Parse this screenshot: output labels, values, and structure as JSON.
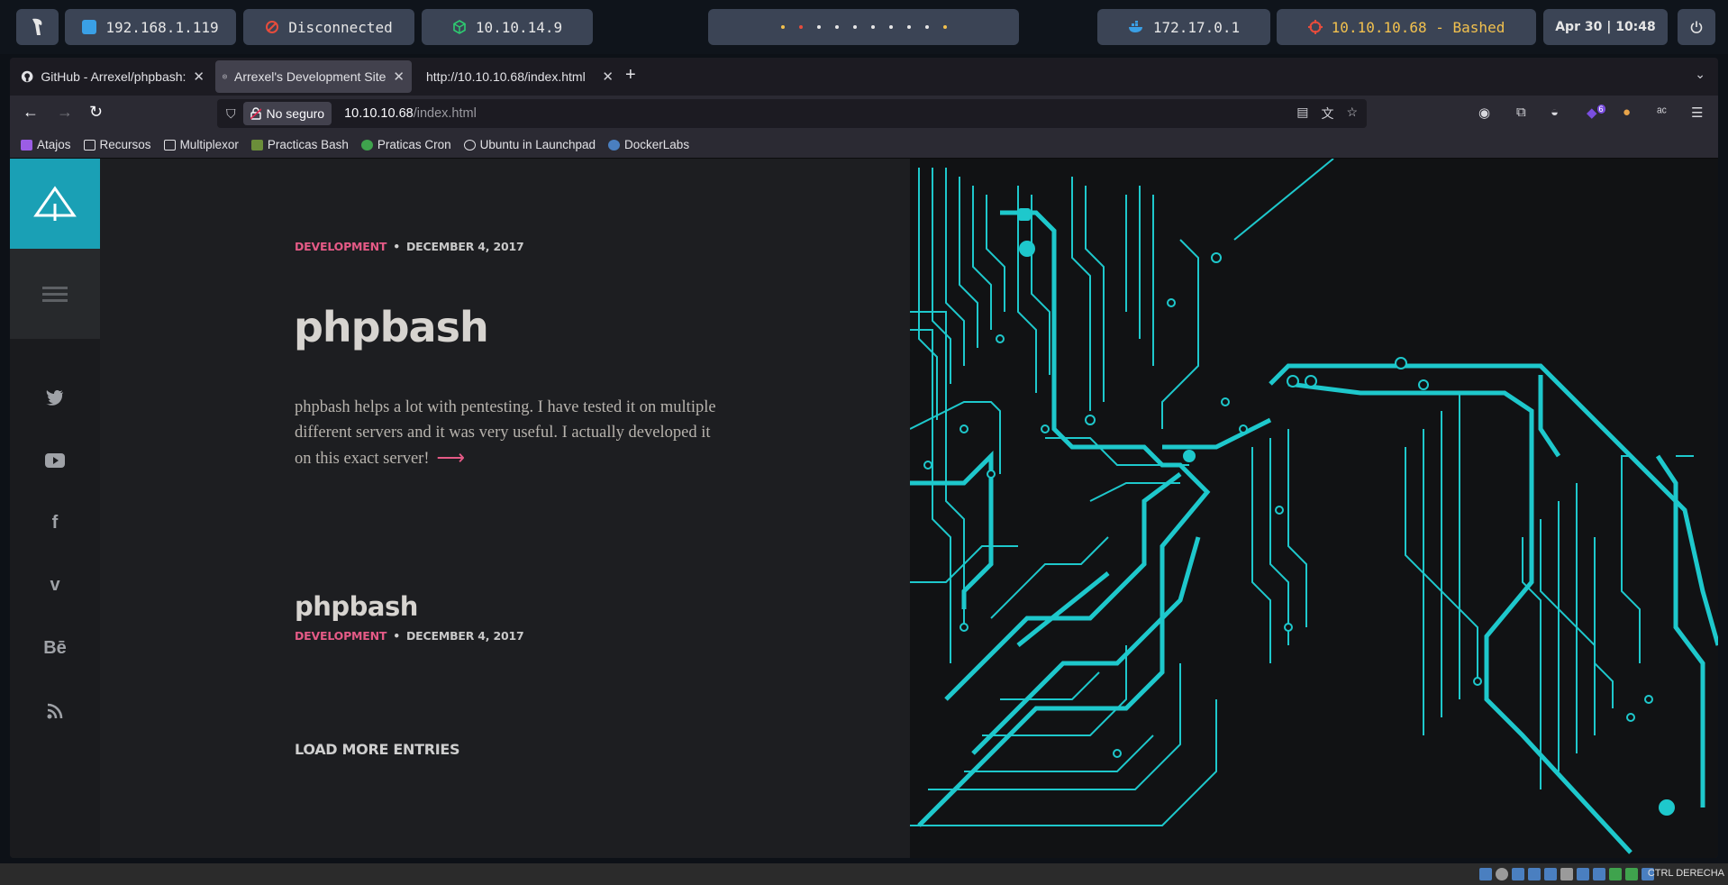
{
  "topbar": {
    "ip_local": "192.168.1.119",
    "vpn_status": "Disconnected",
    "vpn_ip": "10.10.14.9",
    "docker_ip": "172.17.0.1",
    "target": "10.10.10.68 - Bashed",
    "datetime": "Apr 30 | 10:48",
    "colors": {
      "target_text": "#f2c14e",
      "docker_icon": "#3aa0e6",
      "vpn_icon": "#2ecc71",
      "disconnected_icon": "#e74c3c"
    }
  },
  "browser": {
    "tabs": [
      {
        "label": "GitHub - Arrexel/phpbash:",
        "icon": "github-icon"
      },
      {
        "label": "Arrexel's Development Site",
        "icon": "site-icon"
      },
      {
        "label": "http://10.10.10.68/index.html",
        "icon": "none"
      }
    ],
    "security_label": "No seguro",
    "url_host": "10.10.10.68",
    "url_path": "/index.html",
    "bookmarks": [
      "Atajos",
      "Recursos",
      "Multiplexor",
      "Practicas Bash",
      "Praticas Cron",
      "Ubuntu in Launchpad",
      "DockerLabs"
    ],
    "extension_badge": "6"
  },
  "site": {
    "accent": "#1aa0b5",
    "category_color": "#e55a86",
    "post1": {
      "category": "Development",
      "date": "December 4, 2017",
      "title": "phpbash",
      "excerpt": "phpbash helps a lot with pentesting. I have tested it on multiple different servers and it was very useful. I actually developed it on this exact server!"
    },
    "post2": {
      "title": "phpbash",
      "category": "Development",
      "date": "December 4, 2017"
    },
    "load_more": "Load more entries",
    "social_icons": [
      "twitter-icon",
      "youtube-icon",
      "facebook-icon",
      "vimeo-icon",
      "behance-icon",
      "rss-icon"
    ]
  },
  "statusbar": {
    "host_key": "CTRL DERECHA"
  }
}
